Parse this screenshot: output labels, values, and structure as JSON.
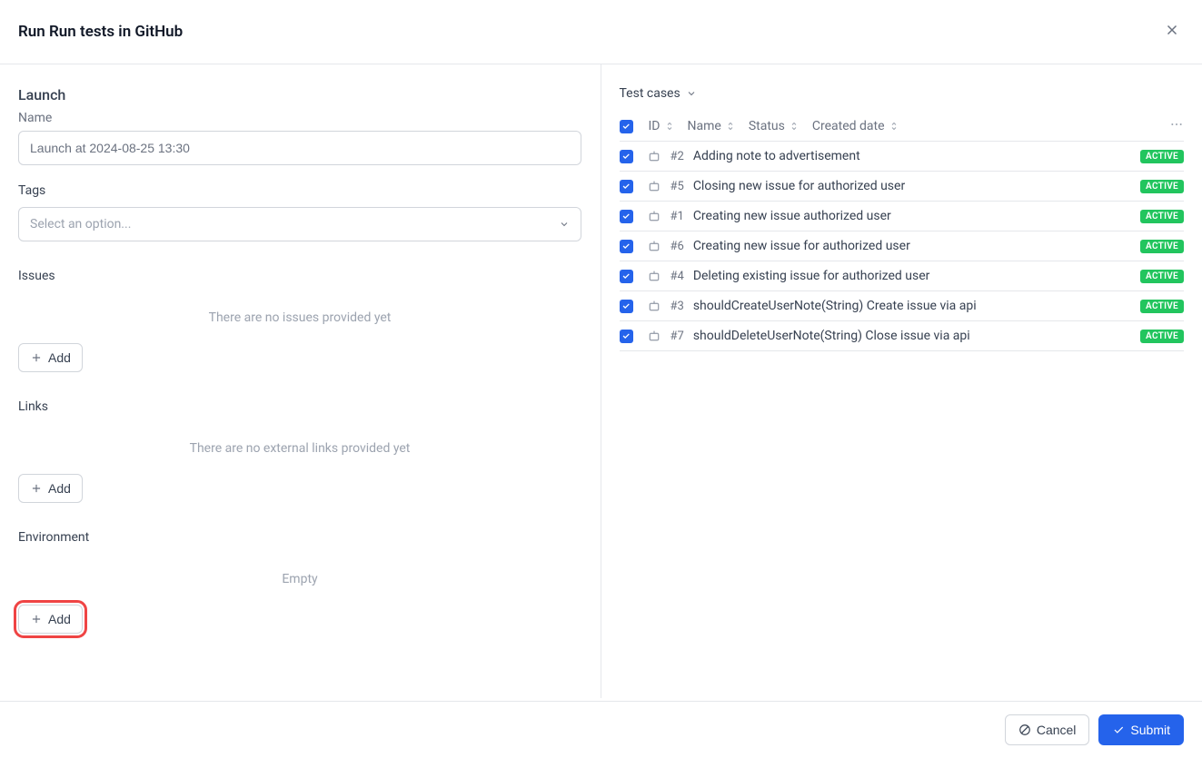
{
  "title": "Run Run tests in GitHub",
  "launch": {
    "section": "Launch",
    "name_label": "Name",
    "name_value": "Launch at 2024-08-25 13:30",
    "tags_label": "Tags",
    "tags_placeholder": "Select an option...",
    "issues_label": "Issues",
    "issues_empty": "There are no issues provided yet",
    "links_label": "Links",
    "links_empty": "There are no external links provided yet",
    "env_label": "Environment",
    "env_empty": "Empty",
    "add_label": "Add"
  },
  "testcases": {
    "header": "Test cases",
    "columns": {
      "id": "ID",
      "name": "Name",
      "status": "Status",
      "created": "Created date"
    },
    "rows": [
      {
        "id": "#2",
        "name": "Adding note to advertisement",
        "status": "ACTIVE"
      },
      {
        "id": "#5",
        "name": "Closing new issue for authorized user",
        "status": "ACTIVE"
      },
      {
        "id": "#1",
        "name": "Creating new issue authorized user",
        "status": "ACTIVE"
      },
      {
        "id": "#6",
        "name": "Creating new issue for authorized user",
        "status": "ACTIVE"
      },
      {
        "id": "#4",
        "name": "Deleting existing issue for authorized user",
        "status": "ACTIVE"
      },
      {
        "id": "#3",
        "name": "shouldCreateUserNote(String) Create issue via api",
        "status": "ACTIVE"
      },
      {
        "id": "#7",
        "name": "shouldDeleteUserNote(String) Close issue via api",
        "status": "ACTIVE"
      }
    ]
  },
  "footer": {
    "cancel": "Cancel",
    "submit": "Submit"
  }
}
